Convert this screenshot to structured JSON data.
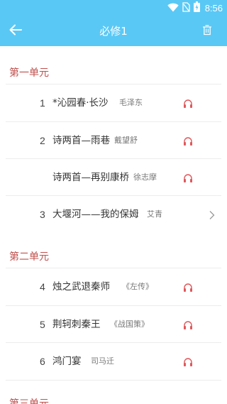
{
  "status_bar": {
    "time": "8:56"
  },
  "app_bar": {
    "title": "必修1"
  },
  "sections": [
    {
      "title": "第一单元",
      "items": [
        {
          "number": "1",
          "title": "*沁园春·长沙",
          "author": "毛泽东",
          "action": "headphones-icon"
        },
        {
          "number": "2",
          "title": "诗两首—雨巷",
          "author": "戴望舒",
          "action": "headphones-icon"
        },
        {
          "number": "",
          "title": "诗两首—再别康桥",
          "author": "徐志摩",
          "action": "headphones-icon"
        },
        {
          "number": "3",
          "title": "大堰河——我的保姆",
          "author": "艾青",
          "action": "chevron-right-icon"
        }
      ]
    },
    {
      "title": "第二单元",
      "items": [
        {
          "number": "4",
          "title": "烛之武退秦师",
          "author": "《左传》",
          "action": "headphones-icon"
        },
        {
          "number": "5",
          "title": "荆轲刺秦王",
          "author": "《战国策》",
          "action": "headphones-icon"
        },
        {
          "number": "6",
          "title": "鸿门宴",
          "author": "司马迁",
          "action": "headphones-icon"
        }
      ]
    },
    {
      "title": "第三单元",
      "items": []
    }
  ],
  "colors": {
    "primary": "#5ac8f5",
    "section_header": "#c0504d",
    "headphones": "#e0575a"
  }
}
